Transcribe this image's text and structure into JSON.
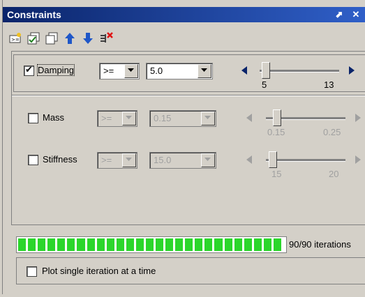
{
  "window": {
    "title": "Constraints",
    "pin_glyph": "⬈",
    "close_glyph": "✕"
  },
  "toolbar": {
    "icons": [
      "add-constraint-icon",
      "check-all-icon",
      "copy-icon",
      "move-up-icon",
      "move-down-icon",
      "delete-constraint-icon"
    ]
  },
  "constraints": [
    {
      "label": "Damping",
      "checked": true,
      "enabled": true,
      "operator": ">=",
      "value": "5.0",
      "min": "5",
      "max": "13",
      "slider_level": 0.0
    },
    {
      "label": "Mass",
      "checked": false,
      "enabled": false,
      "operator": ">=",
      "value": "0.15",
      "min": "0.15",
      "max": "0.25",
      "slider_level": 0.0
    },
    {
      "label": "Stiffness",
      "checked": false,
      "enabled": false,
      "operator": ">=",
      "value": "15.0",
      "min": "15",
      "max": "20",
      "slider_level": 0.0
    }
  ],
  "progress": {
    "text": "90/90 iterations",
    "fraction": 1.0,
    "segments": 27
  },
  "plot_option": {
    "label": "Plot single iteration at a time",
    "checked": false
  },
  "colors": {
    "title_start": "#0a246a",
    "title_end": "#2f5fc8",
    "progress": "#2bd62b",
    "arrow_active": "#0a246a",
    "arrow_disabled": "#a0a0a0"
  }
}
